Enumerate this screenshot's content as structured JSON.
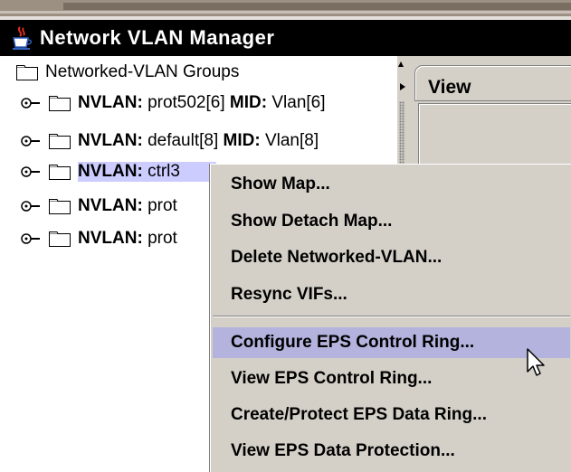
{
  "window": {
    "title": "Network VLAN Manager",
    "icon": "java-cup-icon"
  },
  "tree": {
    "root_label": "Networked-VLAN Groups",
    "items": [
      {
        "nvlan_key": "NVLAN:",
        "nvlan_value": "prot502[6]",
        "mid_key": "MID:",
        "mid_value": "Vlan[6]"
      },
      {
        "nvlan_key": "NVLAN:",
        "nvlan_value": "default[8]",
        "mid_key": "MID:",
        "mid_value": "Vlan[8]"
      },
      {
        "nvlan_key": "NVLAN:",
        "nvlan_value": "ctrl3"
      },
      {
        "nvlan_key": "NVLAN:",
        "nvlan_value": "prot"
      },
      {
        "nvlan_key": "NVLAN:",
        "nvlan_value": "prot"
      }
    ]
  },
  "right_panel": {
    "tab_label": "View"
  },
  "context_menu": {
    "group1": [
      "Show Map...",
      "Show Detach Map...",
      "Delete Networked-VLAN...",
      "Resync VIFs..."
    ],
    "group2": [
      "Configure EPS Control Ring...",
      "View EPS Control Ring...",
      "Create/Protect EPS Data Ring...",
      "View EPS Data Protection..."
    ],
    "highlighted": "Configure EPS Control Ring..."
  },
  "colors": {
    "titlebar_bg": "#000000",
    "selection_bg": "#ccccff",
    "menu_bg": "#d4d0c8",
    "menu_highlight": "#b3b3de"
  }
}
